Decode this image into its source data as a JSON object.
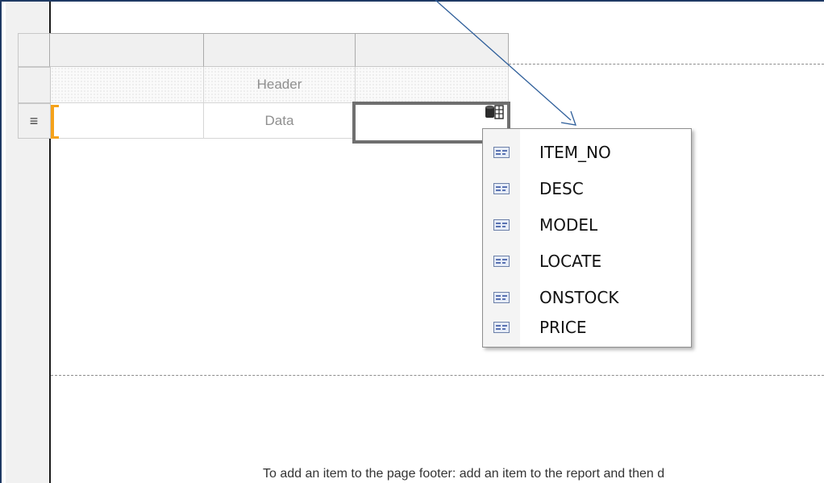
{
  "tablix": {
    "header_label": "Header",
    "data_label": "Data",
    "row_menu_icon": "≡"
  },
  "field_list": {
    "items": [
      {
        "label": "ITEM_NO"
      },
      {
        "label": "DESC"
      },
      {
        "label": "MODEL"
      },
      {
        "label": "LOCATE"
      },
      {
        "label": "ONSTOCK"
      },
      {
        "label": "PRICE"
      }
    ]
  },
  "footer": {
    "hint": "To add an item to the page footer: add an item to the report and then d"
  },
  "colors": {
    "accent": "#f5a21a",
    "arrow": "#2e5e9a",
    "frame": "#1f3a64"
  }
}
